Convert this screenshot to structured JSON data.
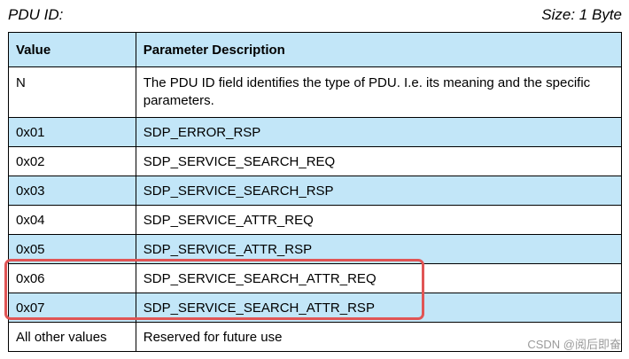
{
  "header": {
    "title": "PDU ID:",
    "size": "Size: 1 Byte"
  },
  "table": {
    "columns": [
      "Value",
      "Parameter Description"
    ],
    "rows": [
      {
        "value": "N",
        "description": "The PDU ID field identifies the type of PDU. I.e. its meaning and the specific parameters."
      },
      {
        "value": "0x01",
        "description": "SDP_ERROR_RSP"
      },
      {
        "value": "0x02",
        "description": "SDP_SERVICE_SEARCH_REQ"
      },
      {
        "value": "0x03",
        "description": "SDP_SERVICE_SEARCH_RSP"
      },
      {
        "value": "0x04",
        "description": "SDP_SERVICE_ATTR_REQ"
      },
      {
        "value": "0x05",
        "description": "SDP_SERVICE_ATTR_RSP"
      },
      {
        "value": "0x06",
        "description": "SDP_SERVICE_SEARCH_ATTR_REQ"
      },
      {
        "value": "0x07",
        "description": "SDP_SERVICE_SEARCH_ATTR_RSP"
      },
      {
        "value": "All other values",
        "description": "Reserved for future use"
      }
    ]
  },
  "watermark": "CSDN @阅后即奋",
  "colors": {
    "header_fill": "#c2e6f8",
    "alt_row_fill": "#c2e6f8",
    "highlight_border": "#e05555"
  }
}
